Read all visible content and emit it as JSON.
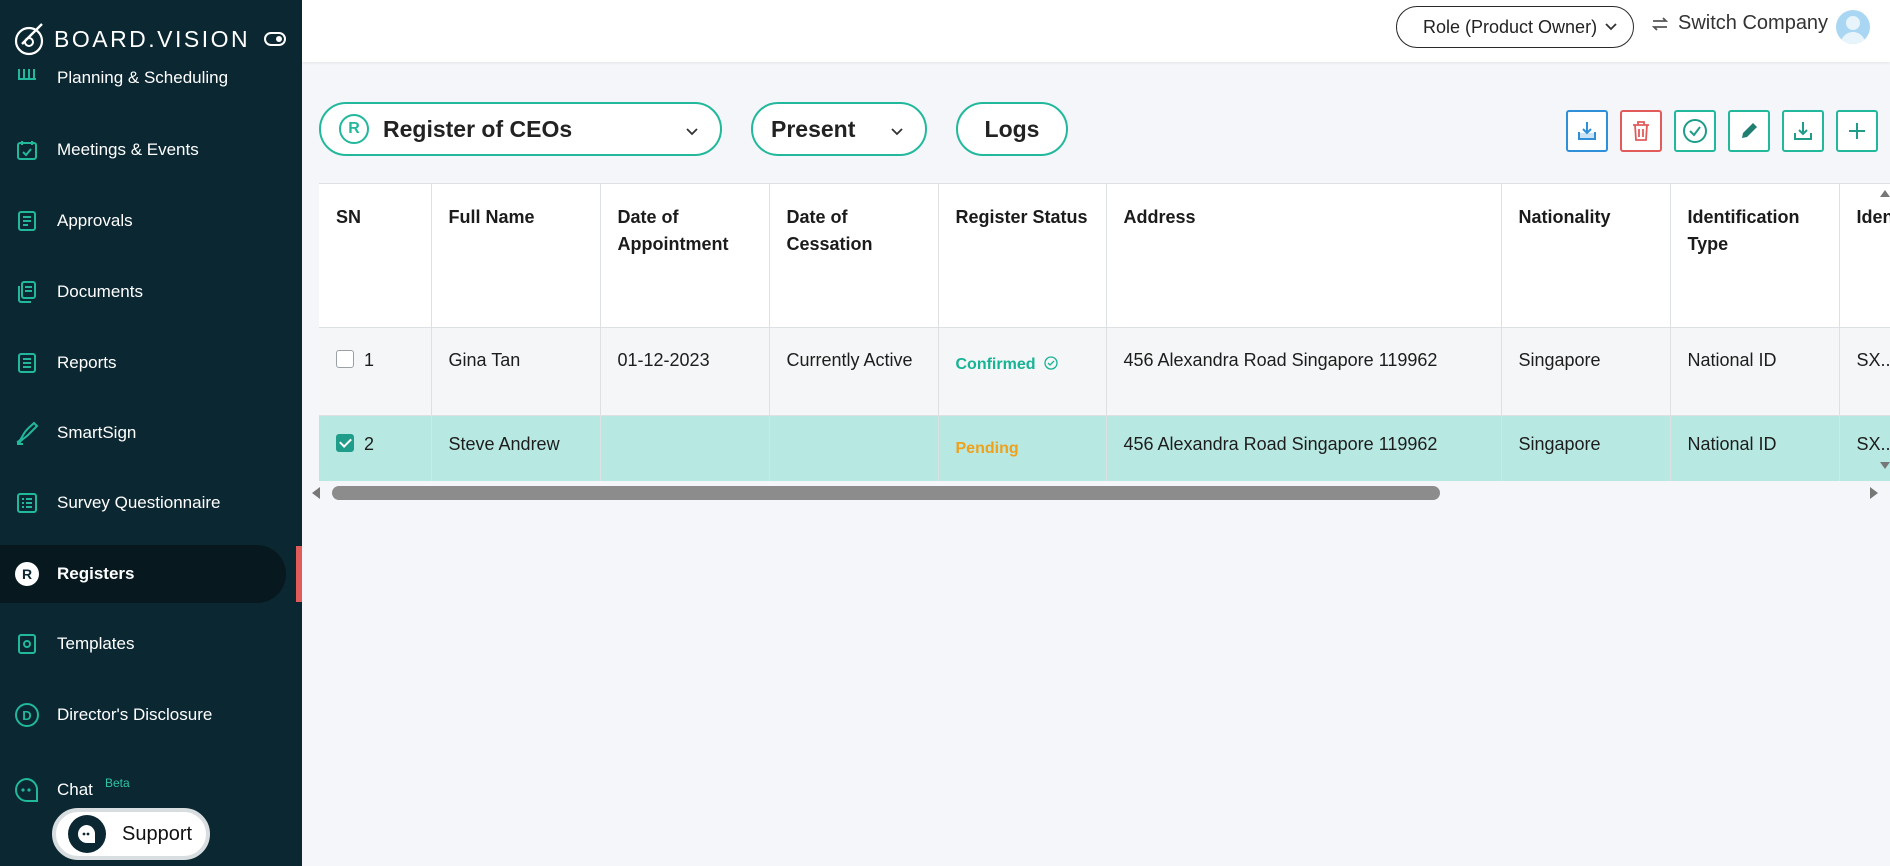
{
  "app": {
    "brand": "BOARD.VISION"
  },
  "sidebar": {
    "items": [
      {
        "label": "Planning & Scheduling",
        "icon": "calendar-grid-icon"
      },
      {
        "label": "Meetings & Events",
        "icon": "calendar-check-icon"
      },
      {
        "label": "Approvals",
        "icon": "approvals-icon"
      },
      {
        "label": "Documents",
        "icon": "documents-icon"
      },
      {
        "label": "Reports",
        "icon": "reports-icon"
      },
      {
        "label": "SmartSign",
        "icon": "smartsign-icon"
      },
      {
        "label": "Survey Questionnaire",
        "icon": "survey-icon"
      },
      {
        "label": "Registers",
        "icon": "registers-icon",
        "active": true
      },
      {
        "label": "Templates",
        "icon": "templates-icon"
      },
      {
        "label": "Director's Disclosure",
        "icon": "disclosure-icon"
      },
      {
        "label": "Chat",
        "icon": "chat-icon",
        "badge": "Beta"
      }
    ],
    "support_label": "Support"
  },
  "topbar": {
    "role_label": "Role (Product Owner)",
    "switch_company_label": "Switch Company"
  },
  "toolbar": {
    "register_badge": "R",
    "register_selected": "Register of CEOs",
    "period_selected": "Present",
    "logs_label": "Logs",
    "actions": [
      "import-icon",
      "delete-icon",
      "confirm-icon",
      "edit-icon",
      "download-icon",
      "add-icon"
    ]
  },
  "table": {
    "columns": [
      "SN",
      "Full Name",
      "Date of Appointment",
      "Date of Cessation",
      "Register Status",
      "Address",
      "Nationality",
      "Identification Type",
      "Identification No."
    ],
    "rows": [
      {
        "checked": false,
        "sn": "1",
        "full_name": "Gina Tan",
        "date_of_appointment": "01-12-2023",
        "date_of_cessation": "Currently Active",
        "status": "Confirmed",
        "address": "456 Alexandra Road Singapore 119962",
        "nationality": "Singapore",
        "identification_type": "National ID",
        "identification_no": "SX..."
      },
      {
        "checked": true,
        "sn": "2",
        "full_name": "Steve Andrew",
        "date_of_appointment": "",
        "date_of_cessation": "",
        "status": "Pending",
        "address": "456 Alexandra Road Singapore 119962",
        "nationality": "Singapore",
        "identification_type": "National ID",
        "identification_no": "SX..."
      }
    ]
  },
  "colors": {
    "sidebar_bg": "#0b2732",
    "accent": "#22b89c",
    "selected_row": "#b8e8e2",
    "confirmed": "#16b394",
    "pending": "#f0a11a",
    "delete": "#e25b5b",
    "import": "#2f8fd8"
  }
}
